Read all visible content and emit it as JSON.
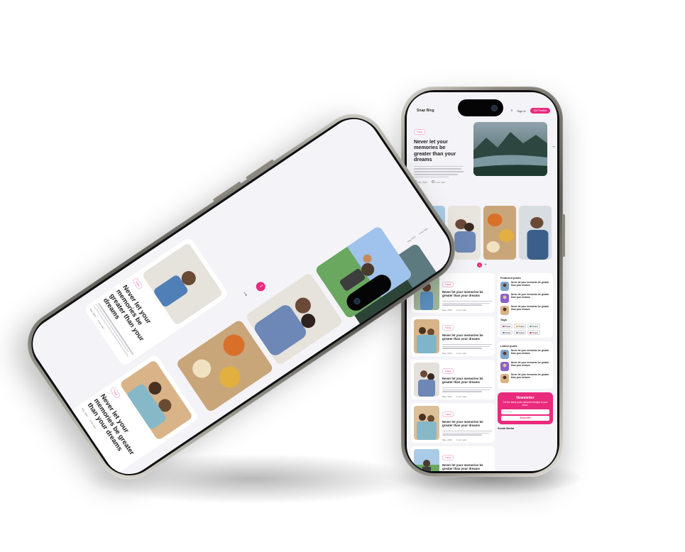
{
  "blog": {
    "logo": "Snap Blog",
    "login": "Sign in",
    "cta": "Get Started",
    "post_title": "Never let your memories be greater than your dreams",
    "post_date": "May, 2023",
    "read_time": "3 min read",
    "chip_label": "Travel",
    "pager_current": "1",
    "pager_next": "+",
    "arrow": "→"
  },
  "sidebar": {
    "featured_heading": "Featured posts",
    "tags_heading": "Tags",
    "latest_heading": "Latest posts",
    "social_heading": "Social Media",
    "tags": [
      {
        "label": "Travel",
        "color": "#ea2a7c"
      },
      {
        "label": "Travel",
        "color": "#f5a623"
      },
      {
        "label": "Travel",
        "color": "#2fae6b"
      },
      {
        "label": "Travel",
        "color": "#3b7be8"
      },
      {
        "label": "Travel",
        "color": "#9b59b6"
      },
      {
        "label": "Travel",
        "color": "#ea2a7c"
      },
      {
        "label": "Travel",
        "color": "#f5a623"
      },
      {
        "label": "Travel",
        "color": "#2fae6b"
      }
    ]
  },
  "newsletter": {
    "title": "Newsletter",
    "subtitle": "Get the latest posts delivered straight to your inbox.",
    "input_placeholder": "Your email",
    "button": "Subscribe"
  },
  "colors": {
    "accent": "#ea2a7c",
    "screen_bg": "#f4f3f7"
  }
}
